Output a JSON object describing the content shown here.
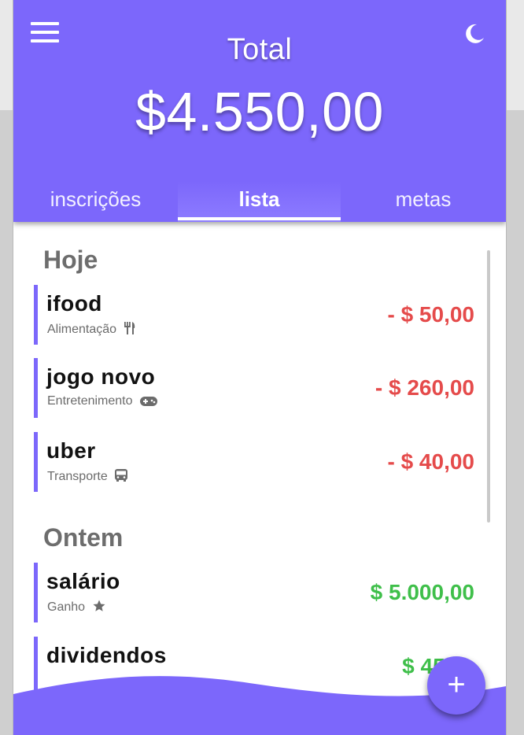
{
  "header": {
    "total_label": "Total",
    "total_value": "$4.550,00",
    "accent_color": "#7c67fb",
    "menu_icon": "hamburger-menu-icon",
    "theme_icon": "moon-icon"
  },
  "tabs": [
    {
      "label": "inscrições",
      "active": false
    },
    {
      "label": "lista",
      "active": true
    },
    {
      "label": "metas",
      "active": false
    }
  ],
  "sections": [
    {
      "title": "Hoje",
      "items": [
        {
          "title": "ifood",
          "category": "Alimentação",
          "icon": "utensils-icon",
          "amount": "- $ 50,00",
          "type": "expense"
        },
        {
          "title": "jogo novo",
          "category": "Entretenimento",
          "icon": "gamepad-icon",
          "amount": "- $ 260,00",
          "type": "expense"
        },
        {
          "title": "uber",
          "category": "Transporte",
          "icon": "bus-icon",
          "amount": "- $ 40,00",
          "type": "expense"
        }
      ]
    },
    {
      "title": "Ontem",
      "items": [
        {
          "title": "salário",
          "category": "Ganho",
          "icon": "star-icon",
          "amount": "$ 5.000,00",
          "type": "income"
        },
        {
          "title": "dividendos",
          "category": "",
          "icon": "",
          "amount": "$ 45,0",
          "type": "income"
        }
      ]
    }
  ],
  "fab": {
    "label": "+"
  },
  "colors": {
    "expense": "#e54b4b",
    "income": "#3fbf4a",
    "section_title": "#6d6d6d"
  }
}
